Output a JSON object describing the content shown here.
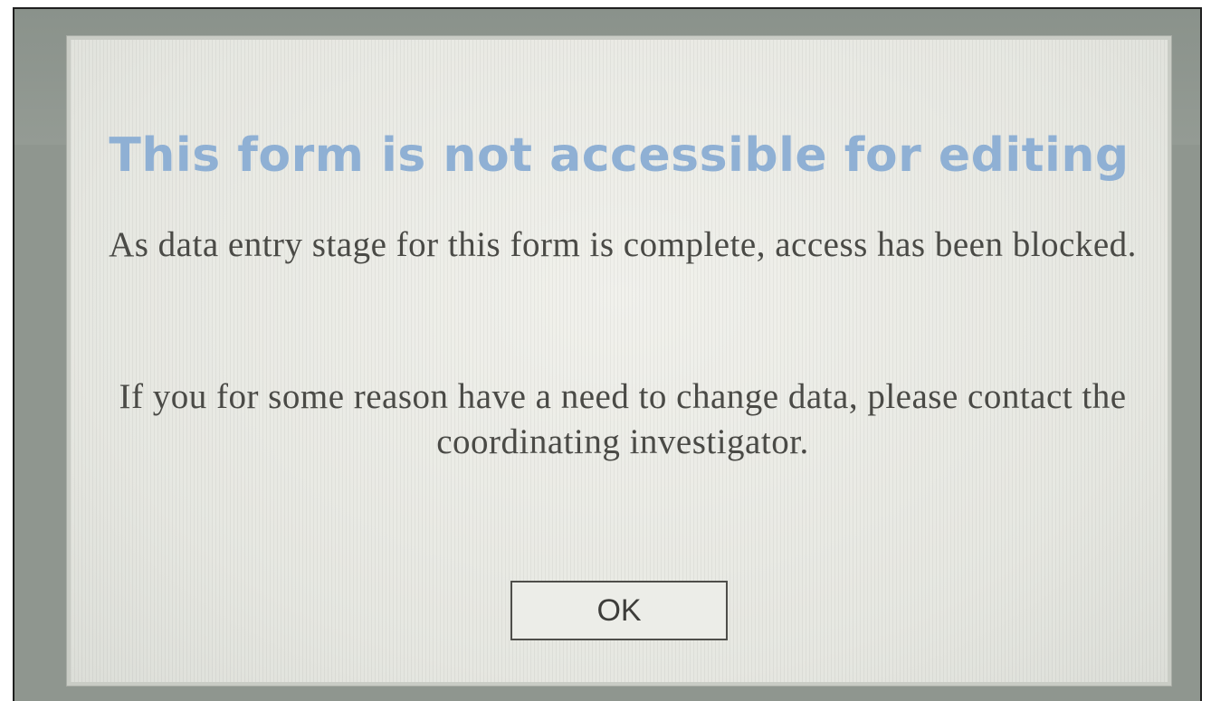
{
  "dialog": {
    "title": "This form is not accessible for editing",
    "message_1": "As data entry stage for this form is complete, access has been blocked.",
    "message_2": "If you for some reason have a need to change data, please contact the coordinating investigator.",
    "ok_label": "OK"
  },
  "colors": {
    "title": "#8fb0d4",
    "text": "#4a4a46",
    "dialog_bg": "#e9eae5",
    "backdrop": "#8f968f"
  }
}
